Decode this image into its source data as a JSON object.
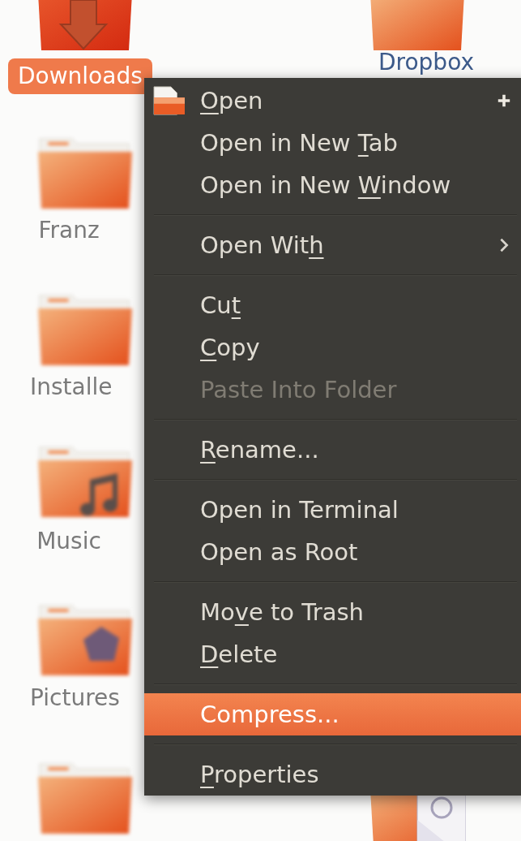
{
  "desktop_icons": [
    {
      "kind": "downloads",
      "label": "Downloads",
      "selected": true
    },
    {
      "kind": "folder",
      "label": "Dropbox",
      "selected": false
    },
    {
      "kind": "folder",
      "label": "Franz",
      "selected": false
    },
    {
      "kind": "folder",
      "label": "Installe",
      "selected": false
    },
    {
      "kind": "music",
      "label": "Music",
      "selected": false
    },
    {
      "kind": "pictures",
      "label": "Pictures",
      "selected": false
    },
    {
      "kind": "folder"
    },
    {
      "kind": "document"
    }
  ],
  "context_menu": {
    "items": [
      {
        "kind": "open_item",
        "key": "O",
        "after": "pen",
        "disabled": false,
        "selected": false
      },
      {
        "kind": "item",
        "before": "Open in New ",
        "key": "T",
        "after": "ab",
        "disabled": false,
        "selected": false
      },
      {
        "kind": "item",
        "before": "Open in New ",
        "key": "W",
        "after": "indow",
        "disabled": false,
        "selected": false
      },
      {
        "kind": "separator"
      },
      {
        "kind": "submenu_item",
        "before": "Open Wit",
        "key": "h",
        "disabled": false,
        "selected": false
      },
      {
        "kind": "separator"
      },
      {
        "kind": "item",
        "before": "Cu",
        "key": "t",
        "disabled": false,
        "selected": false
      },
      {
        "kind": "item",
        "key": "C",
        "after": "opy",
        "disabled": false,
        "selected": false
      },
      {
        "kind": "item",
        "label": "Paste Into Folder",
        "disabled": true,
        "selected": false
      },
      {
        "kind": "separator"
      },
      {
        "kind": "item",
        "key": "R",
        "after": "ename...",
        "disabled": false,
        "selected": false
      },
      {
        "kind": "separator"
      },
      {
        "kind": "item",
        "label": "Open in Terminal",
        "disabled": false,
        "selected": false
      },
      {
        "kind": "item",
        "label": "Open as Root",
        "disabled": false,
        "selected": false
      },
      {
        "kind": "separator"
      },
      {
        "kind": "item",
        "before": "Mo",
        "key": "v",
        "after": "e to Trash",
        "disabled": false,
        "selected": false
      },
      {
        "kind": "item",
        "key": "D",
        "after": "elete",
        "disabled": false,
        "selected": false
      },
      {
        "kind": "separator"
      },
      {
        "kind": "item",
        "label": "Compress...",
        "disabled": false,
        "selected": true
      },
      {
        "kind": "separator"
      },
      {
        "kind": "item",
        "key": "P",
        "after": "roperties",
        "disabled": false,
        "selected": false
      }
    ]
  }
}
